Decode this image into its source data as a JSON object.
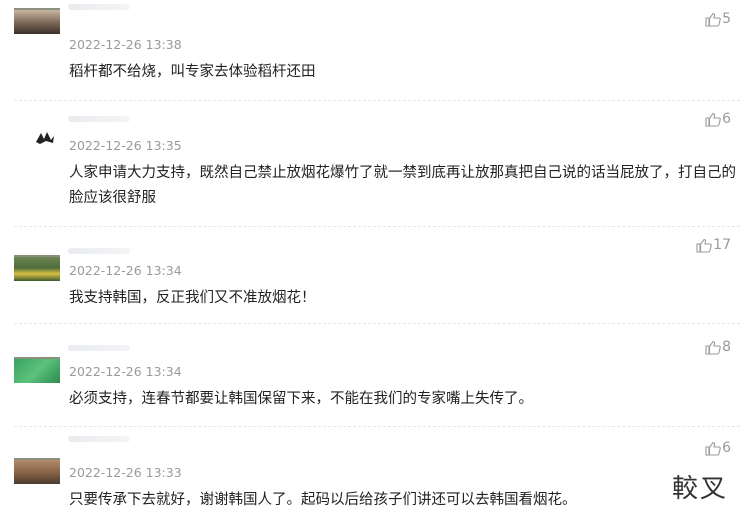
{
  "comments": [
    {
      "time": "2022-12-26 13:38",
      "likes": "5",
      "text": "稻杆都不给烧，叫专家去体验稻杆还田"
    },
    {
      "time": "2022-12-26 13:35",
      "likes": "6",
      "text": "人家申请大力支持，既然自己禁止放烟花爆竹了就一禁到底再让放那真把自己说的话当屁放了，打自己的脸应该很舒服"
    },
    {
      "time": "2022-12-26 13:34",
      "likes": "17",
      "text": "我支持韩国，反正我们又不准放烟花！"
    },
    {
      "time": "2022-12-26 13:34",
      "likes": "8",
      "text": "必须支持，连春节都要让韩国保留下来，不能在我们的专家嘴上失传了。"
    },
    {
      "time": "2022-12-26 13:33",
      "likes": "6",
      "text": "只要传承下去就好，谢谢韩国人了。起码以后给孩子们讲还可以去韩国看烟花。"
    }
  ],
  "icons": {
    "like": "thumbs-up-icon"
  },
  "watermark": "較叉"
}
